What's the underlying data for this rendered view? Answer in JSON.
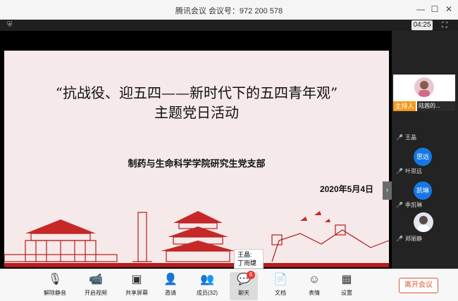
{
  "window": {
    "title": "腾讯会议  会议号：972 200 578"
  },
  "meeting": {
    "timer": "04:25"
  },
  "slide": {
    "title_line1": "“抗战役、迎五四——新时代下的五四青年观”",
    "title_line2": "主题党日活动",
    "organization": "制药与生命科学学院研究生党支部",
    "date": "2020年5月4日"
  },
  "tooltip": {
    "line1": "王晶:",
    "line2": "丁雨婕"
  },
  "participants": {
    "host_badge": "主持人",
    "host_name": "陆茜的...",
    "list": [
      {
        "name": "王晶"
      },
      {
        "name": "叶思远",
        "avatar_text": "思远"
      },
      {
        "name": "季凯琳",
        "avatar_text": "凯琳"
      },
      {
        "name": "郑丽静"
      }
    ]
  },
  "toolbar": {
    "mute": "解除静音",
    "video": "开启视频",
    "share": "共享屏幕",
    "invite": "邀请",
    "members": "成员(32)",
    "chat": "聊天",
    "chat_badge": "6",
    "docs": "文档",
    "emoji": "表情",
    "settings": "设置",
    "leave": "离开会议"
  },
  "colors": {
    "accent": "#1677e5",
    "end": "#e0553a",
    "slide_red": "#b81c1c",
    "host_badge": "#f39a1e"
  }
}
